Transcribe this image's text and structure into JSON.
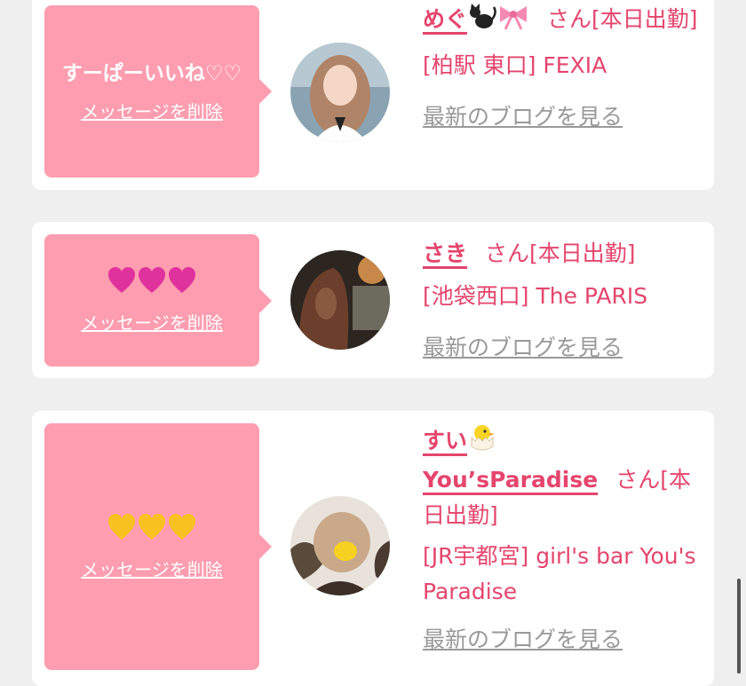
{
  "colors": {
    "background": "#efefef",
    "card": "#ffffff",
    "bubble": "#ff9db0",
    "accent": "#e5456d",
    "blog_link": "#999999"
  },
  "items": [
    {
      "message": "すーぱーいいね♡♡",
      "delete_label": "メッセージを削除",
      "name": "めぐ",
      "name_icons": [
        "black-cat-icon",
        "pink-ribbon-icon"
      ],
      "suffix": "さん[本日出勤]",
      "location": "[柏駅 東口] FEXIA",
      "blog_label": "最新のブログを見る"
    },
    {
      "message": "💗💗💗",
      "message_icons": [
        "pink-heart-icon",
        "pink-heart-icon",
        "pink-heart-icon"
      ],
      "delete_label": "メッセージを削除",
      "name": "さき",
      "suffix": "さん[本日出勤]",
      "location": "[池袋西口] The PARIS",
      "blog_label": "最新のブログを見る"
    },
    {
      "message": "💛💛💛",
      "message_icons": [
        "yellow-heart-icon",
        "yellow-heart-icon",
        "yellow-heart-icon"
      ],
      "delete_label": "メッセージを削除",
      "name": "すい",
      "name_icons": [
        "hatching-chick-icon"
      ],
      "name_line2": "You’sParadise",
      "suffix": "さん[本日出勤]",
      "location": "[JR宇都宮] girl's bar You's Paradise",
      "blog_label": "最新のブログを見る"
    }
  ]
}
